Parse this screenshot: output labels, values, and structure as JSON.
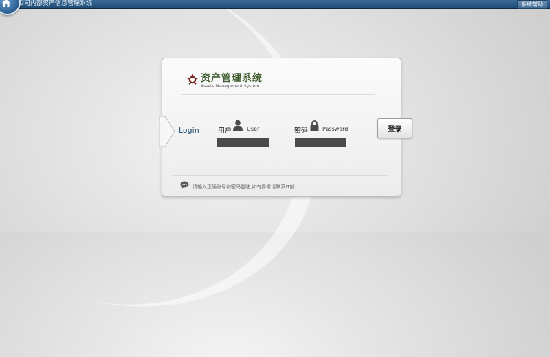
{
  "topbar": {
    "title": "公司内部资产信息管理系统",
    "help_label": "系统帮助"
  },
  "logo": {
    "title_cn": "资产管理系统",
    "title_en": "Assets Management System"
  },
  "login": {
    "label": "Login",
    "user_label": "用户",
    "user_sublabel": "User",
    "password_label": "密码",
    "password_sublabel": "Password",
    "submit_label": "登录"
  },
  "notice": {
    "text": "请输入正确账号和密码登陆,如有异常请联系IT部"
  },
  "colors": {
    "topbar": "#2b5c8a",
    "brand_text": "#3c5a2c",
    "login_accent": "#1f4e72",
    "input_fill": "#4a4a4a"
  }
}
